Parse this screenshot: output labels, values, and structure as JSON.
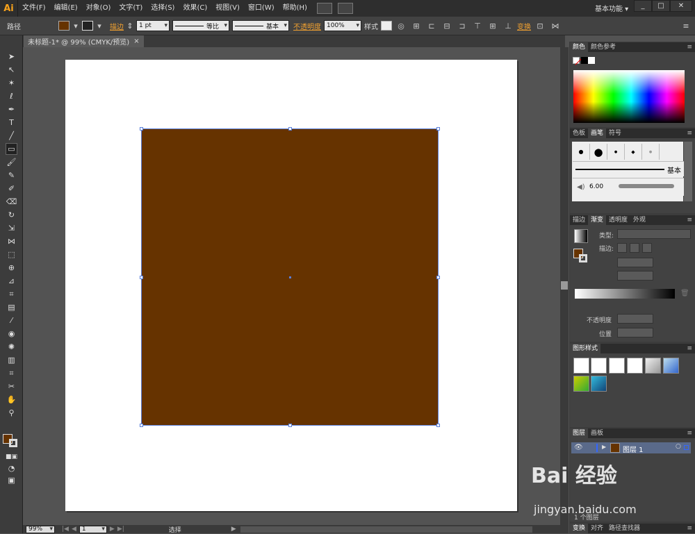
{
  "app": {
    "logo": "Ai",
    "workspace": "基本功能"
  },
  "menu": [
    "文件(F)",
    "编辑(E)",
    "对象(O)",
    "文字(T)",
    "选择(S)",
    "效果(C)",
    "视图(V)",
    "窗口(W)",
    "帮助(H)"
  ],
  "window_buttons": [
    "_",
    "□",
    "✕"
  ],
  "control": {
    "selection_type": "路径",
    "fill_color": "#663300",
    "stroke_label": "描边",
    "stroke_weight": "1 pt",
    "profile_label": "等比",
    "brush_label": "基本",
    "opacity_label": "不透明度",
    "opacity_value": "100%",
    "style_label": "样式",
    "transform_label": "变换"
  },
  "document": {
    "tab_title": "未标题-1* @ 99% (CMYK/预览)",
    "close": "×"
  },
  "shape": {
    "fill": "#663300",
    "selection_color": "#5a7fd9"
  },
  "status": {
    "zoom": "99%",
    "page": "1",
    "tool": "选择"
  },
  "panels": {
    "color_tabs": [
      "颜色",
      "颜色参考"
    ],
    "swatch_tabs": [
      "色板",
      "画笔",
      "符号"
    ],
    "brush_basic": "基本",
    "brush_size": "6.00",
    "gradient_tabs": [
      "描边",
      "渐变",
      "透明度",
      "外观"
    ],
    "gradient_type_label": "类型:",
    "gradient_stroke_label": "描边:",
    "gradient_opacity_label": "不透明度",
    "gradient_position_label": "位置",
    "graphic_styles_tab": "图形样式",
    "layers_tabs": [
      "图层",
      "画板"
    ],
    "layer_name": "图层 1",
    "layers_count": "1 个图层",
    "bottom_tabs": [
      "变换",
      "对齐",
      "路径查找器"
    ]
  },
  "watermark": {
    "brand": "Bai 经验",
    "url": "jingyan.baidu.com"
  }
}
